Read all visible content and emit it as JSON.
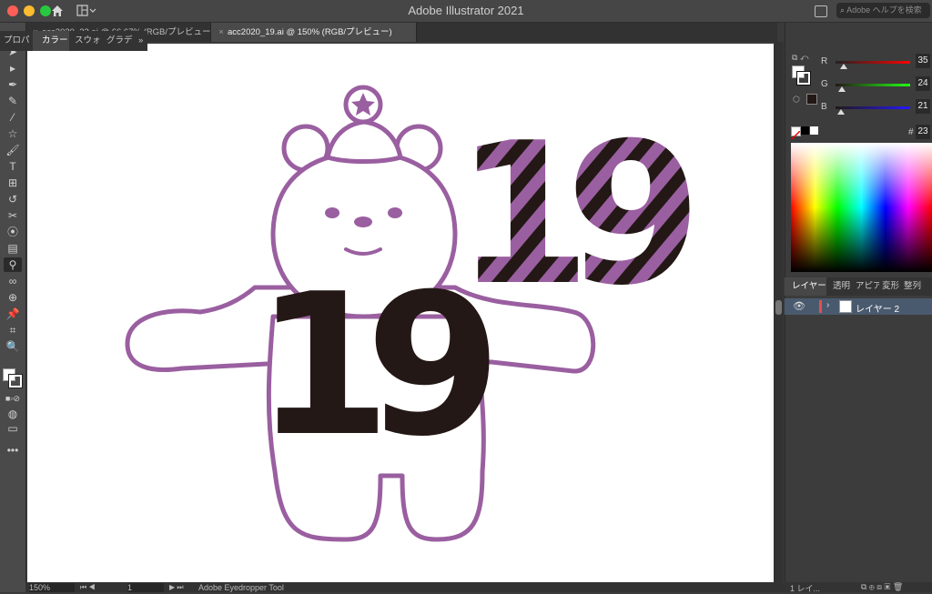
{
  "app": {
    "title": "Adobe Illustrator 2021"
  },
  "help_search": {
    "placeholder": "Adobe ヘルプを検索"
  },
  "tabs": [
    {
      "label": "acc2020_22.ai @ 66.67% (RGB/プレビュー)",
      "active": false
    },
    {
      "label": "acc2020_19.ai @ 150% (RGB/プレビュー)",
      "active": true
    }
  ],
  "tools": [
    "selection-tool",
    "direct-selection-tool",
    "pen-tool",
    "curvature-tool",
    "scissors-tool",
    "star-tool",
    "paintbrush-tool",
    "type-tool",
    "artboard-tool",
    "rotate-tool",
    "width-tool",
    "warp-tool",
    "gradient-tool",
    "eyedropper-tool",
    "blend-tool",
    "shape-builder-tool",
    "pin-tool",
    "artboard-resize-tool",
    "zoom-tool"
  ],
  "color_panel": {
    "tabs": [
      "プロパ",
      "カラー",
      "スウォ",
      "グラデ"
    ],
    "active_tab": "カラー",
    "r": {
      "label": "R",
      "value": "35"
    },
    "g": {
      "label": "G",
      "value": "24"
    },
    "b": {
      "label": "B",
      "value": "21"
    },
    "hex_label": "#",
    "hex_value": "23"
  },
  "layers_panel": {
    "tabs": [
      "レイヤー",
      "透明",
      "アピア",
      "変形",
      "整列"
    ],
    "active_tab": "レイヤー",
    "layer_name": "レイヤー 2",
    "footer_label": "1 レイ..."
  },
  "status": {
    "zoom": "150%",
    "artboard": "1",
    "tool_name": "Adobe Eyedropper Tool"
  },
  "artwork": {
    "number_text": "19",
    "bear_outline_color": "#9a5fa0",
    "number_fill_color": "#231815",
    "stripe_color": "#9a5fa0"
  }
}
